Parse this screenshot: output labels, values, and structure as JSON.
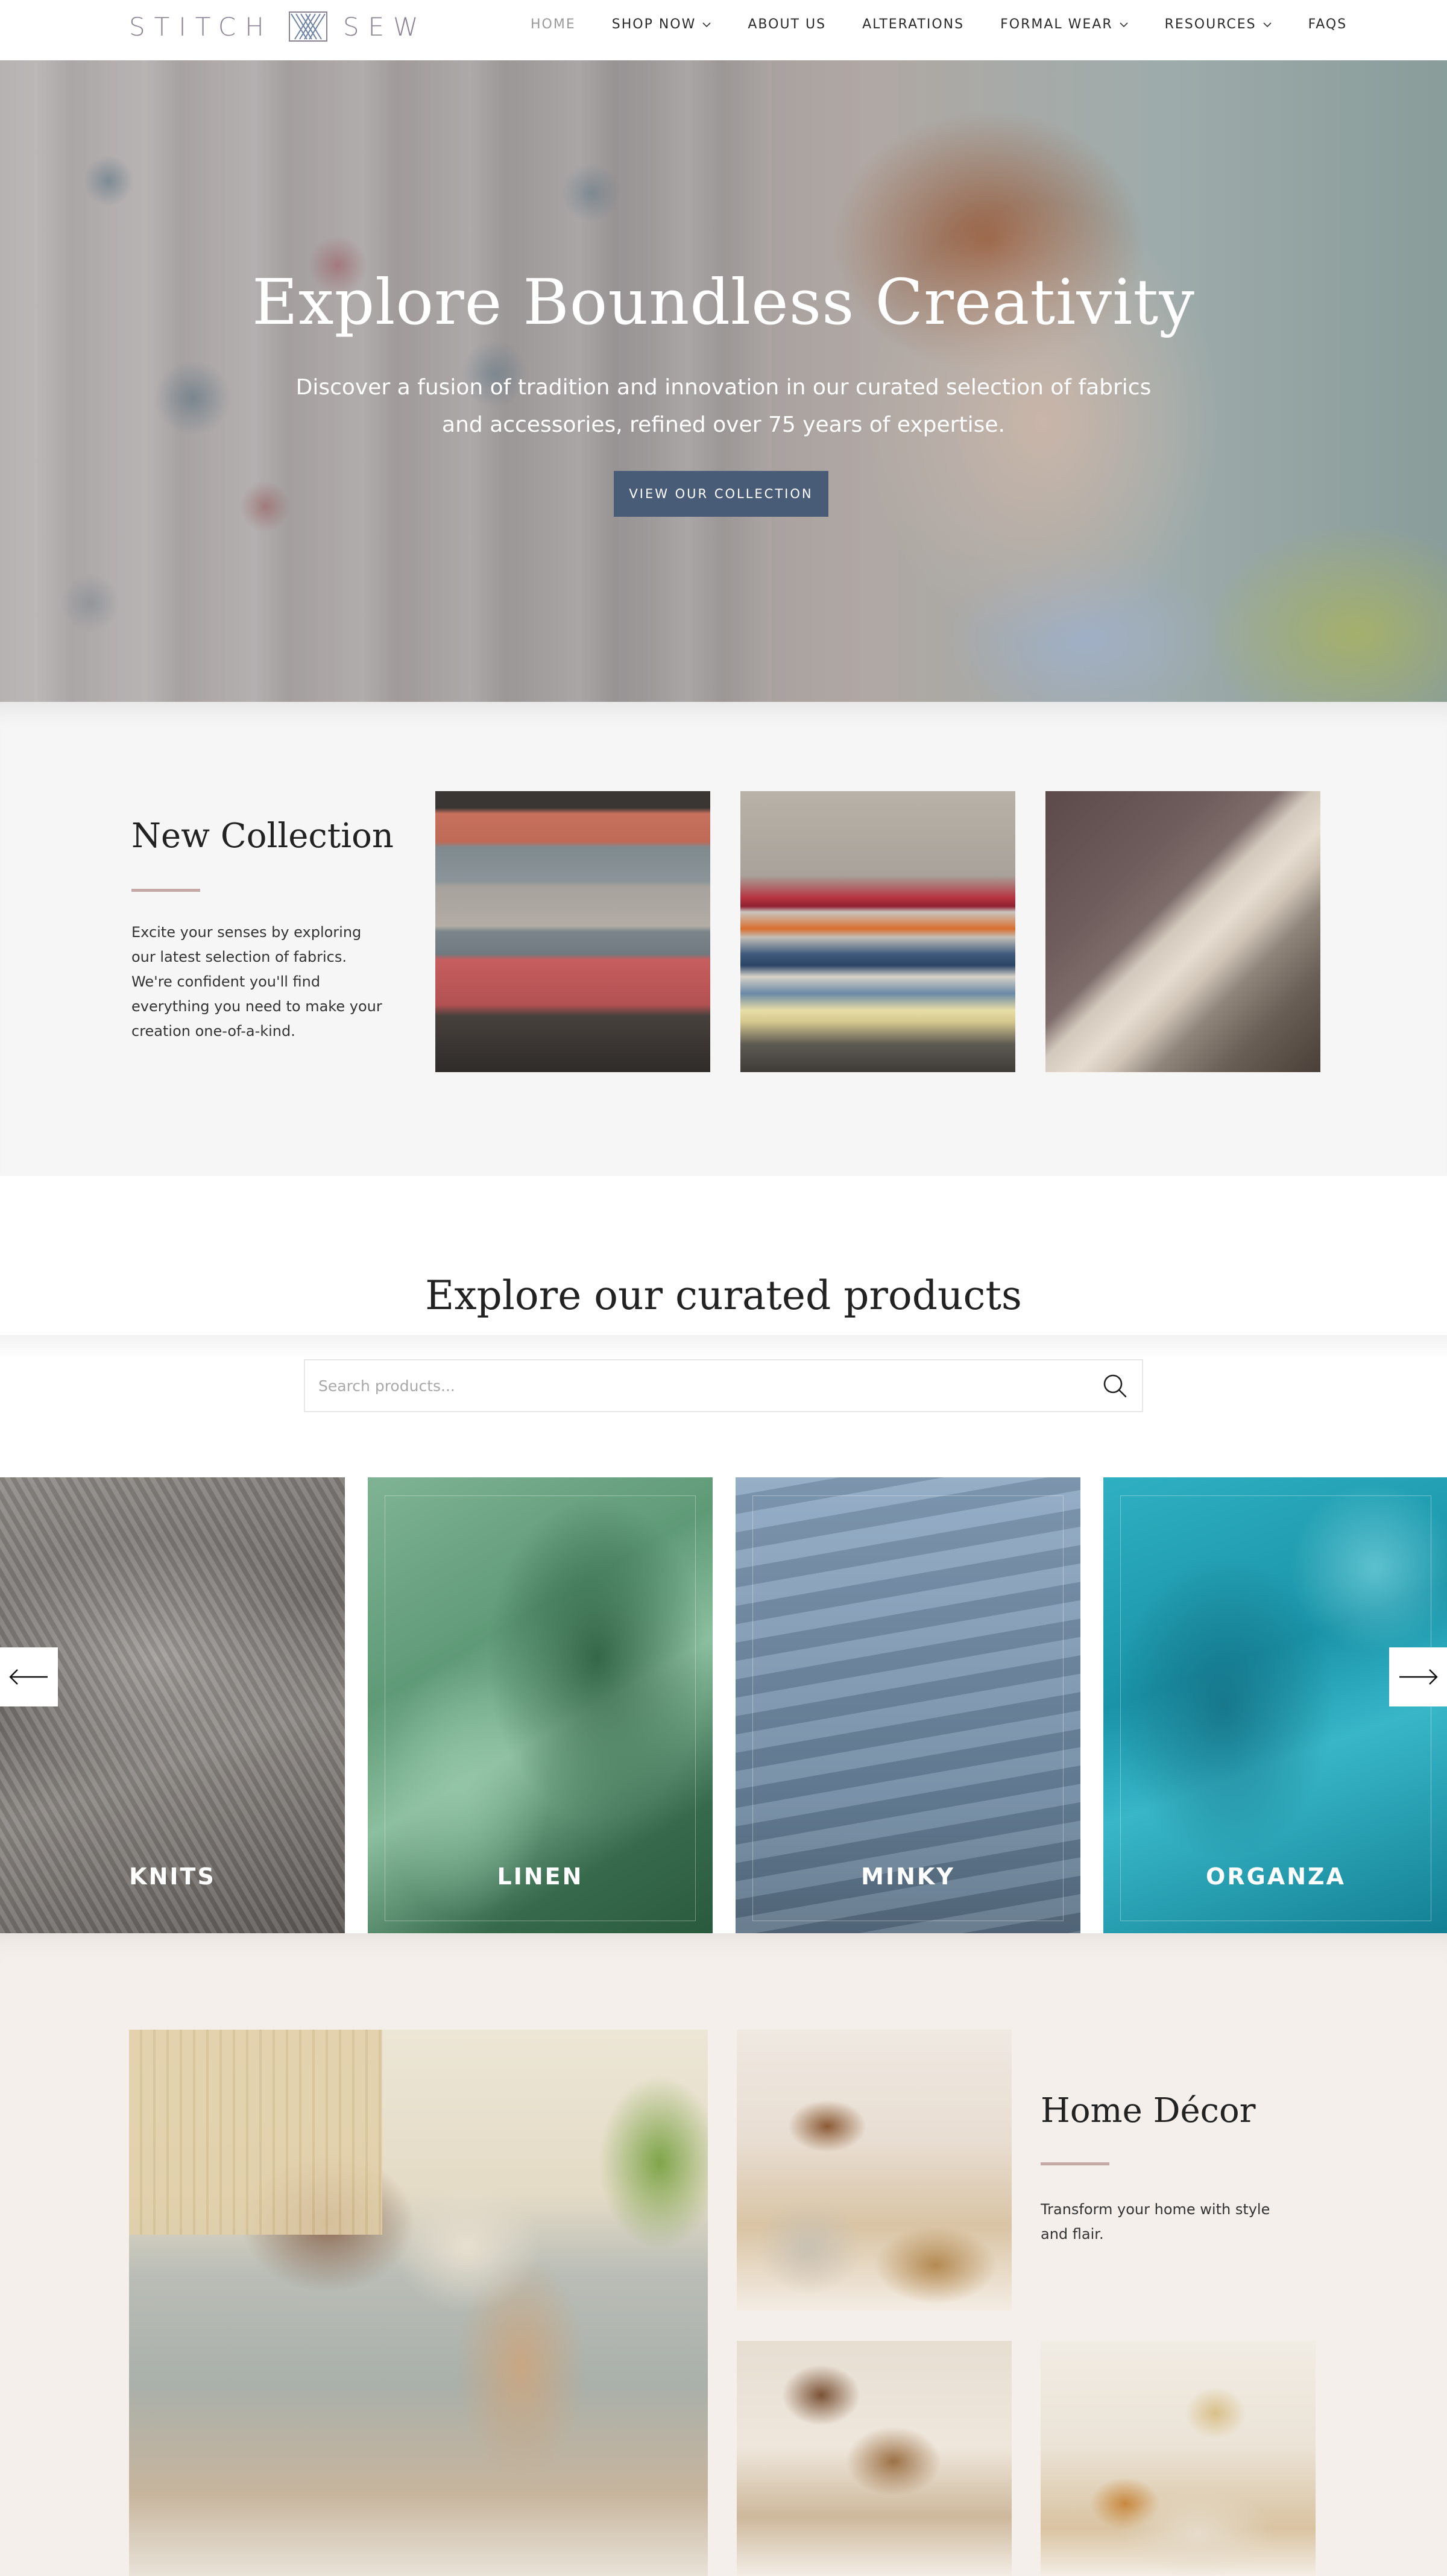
{
  "header": {
    "logo_left": "STITCH",
    "logo_right": "SEW",
    "nav": [
      {
        "label": "HOME",
        "active": true,
        "dropdown": false
      },
      {
        "label": "SHOP NOW",
        "active": false,
        "dropdown": true
      },
      {
        "label": "ABOUT US",
        "active": false,
        "dropdown": false
      },
      {
        "label": "ALTERATIONS",
        "active": false,
        "dropdown": false
      },
      {
        "label": "FORMAL WEAR",
        "active": false,
        "dropdown": true
      },
      {
        "label": "RESOURCES",
        "active": false,
        "dropdown": true
      },
      {
        "label": "FAQS",
        "active": false,
        "dropdown": false
      }
    ]
  },
  "hero": {
    "title": "Explore Boundless Creativity",
    "subtitle": "Discover a fusion of tradition and innovation in our curated selection of fabrics and accessories, refined over 75 years of expertise.",
    "button": "VIEW OUR COLLECTION"
  },
  "new_collection": {
    "title": "New Collection",
    "text": "Excite your senses by exploring our latest selection of fabrics. We're confident you'll find everything you need to make your creation one-of-a-kind."
  },
  "explore": {
    "title": "Explore our curated products",
    "search_placeholder": "Search products...",
    "categories": [
      "KNITS",
      "LINEN",
      "MINKY",
      "ORGANZA"
    ]
  },
  "home_decor": {
    "title": "Home Décor",
    "text": "Transform your home with style and flair."
  },
  "colors": {
    "accent_button": "#485c78",
    "rule": "#c5a9a6",
    "logo": "#8b8294",
    "decor_bg": "#f5efeb",
    "collection_bg": "#f6f6f6"
  },
  "icons": [
    "logo-mark-icon",
    "chevron-down-icon",
    "search-icon",
    "arrow-left-icon",
    "arrow-right-icon"
  ]
}
